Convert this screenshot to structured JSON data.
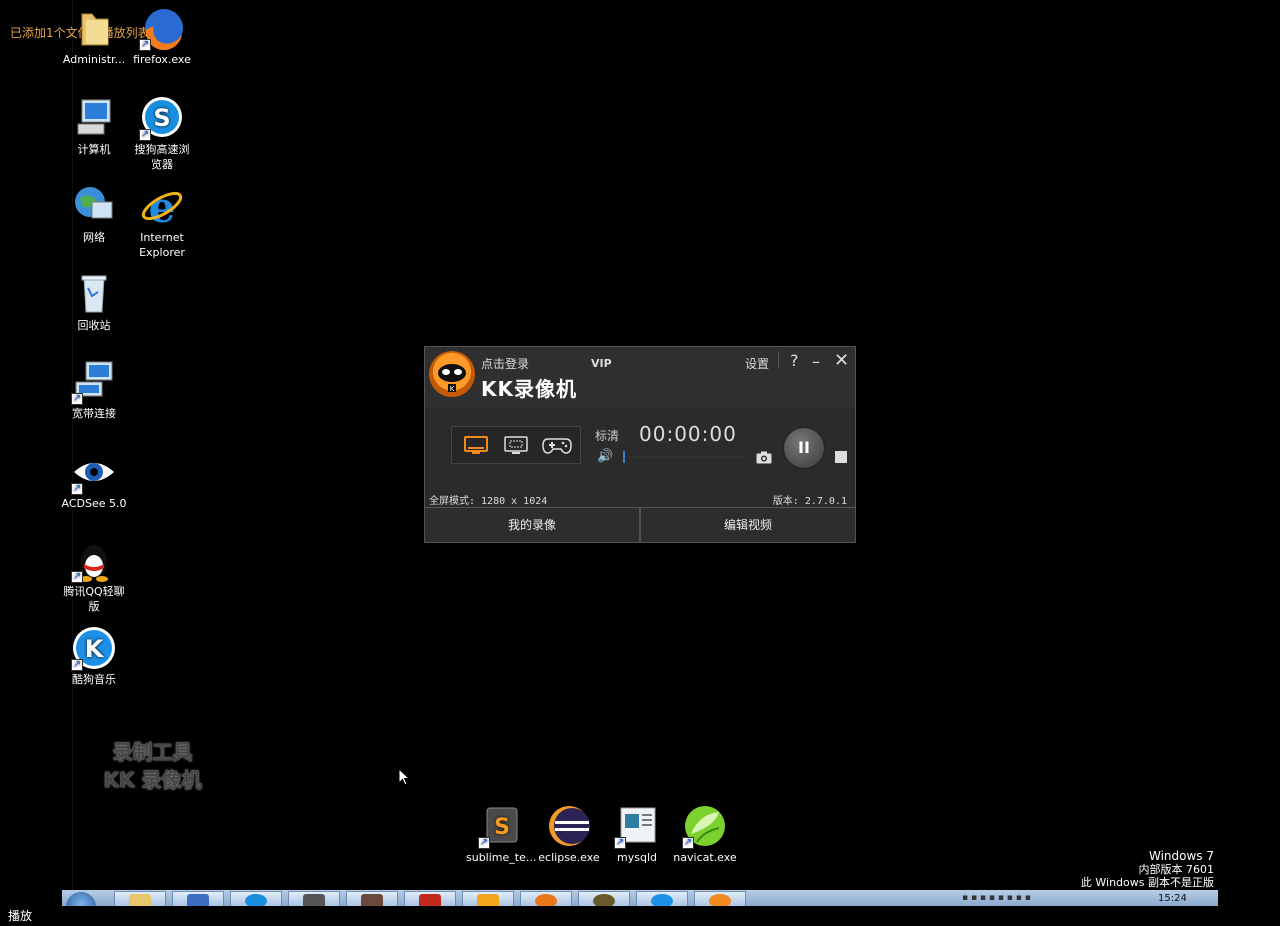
{
  "overlay_message": "已添加1个文件到播放列表",
  "desktop_icons": [
    {
      "label": "Administr...",
      "icon": "folder-icon"
    },
    {
      "label": "firefox.exe",
      "icon": "firefox-icon"
    },
    {
      "label": "计算机",
      "icon": "computer-icon"
    },
    {
      "label": "搜狗高速浏览器",
      "icon": "sogou-browser-icon"
    },
    {
      "label": "网络",
      "icon": "network-icon"
    },
    {
      "label": "Internet Explorer",
      "icon": "ie-icon"
    },
    {
      "label": "回收站",
      "icon": "recycle-bin-icon"
    },
    {
      "label": "宽带连接",
      "icon": "broadband-icon"
    },
    {
      "label": "ACDSee 5.0",
      "icon": "acdsee-icon"
    },
    {
      "label": "腾讯QQ轻聊版",
      "icon": "qq-icon"
    },
    {
      "label": "酷狗音乐",
      "icon": "kugou-icon"
    },
    {
      "label": "sublime_te...",
      "icon": "sublime-icon"
    },
    {
      "label": "eclipse.exe",
      "icon": "eclipse-icon"
    },
    {
      "label": "mysqld",
      "icon": "mysqld-icon"
    },
    {
      "label": "navicat.exe",
      "icon": "navicat-icon"
    }
  ],
  "watermark": {
    "line1": "录制工具",
    "line2": "KK 录像机"
  },
  "kk": {
    "brand": "KK录像机",
    "login": "点击登录",
    "vip": "VIP",
    "settings": "设置",
    "help": "?",
    "minimize": "–",
    "close": "✕",
    "quality": "标清",
    "timer": "00:00:00",
    "fullscreen_mode": "全屏模式: 1280 x 1024",
    "version": "版本: 2.7.0.1",
    "my_recordings": "我的录像",
    "edit_video": "编辑视频",
    "pause_glyph": "II"
  },
  "windows": {
    "line1": "Windows 7",
    "line2": "内部版本 7601",
    "line3": "此 Windows 副本不是正版"
  },
  "taskbar": {
    "clock": "15:24"
  },
  "bottom_label": "播放"
}
